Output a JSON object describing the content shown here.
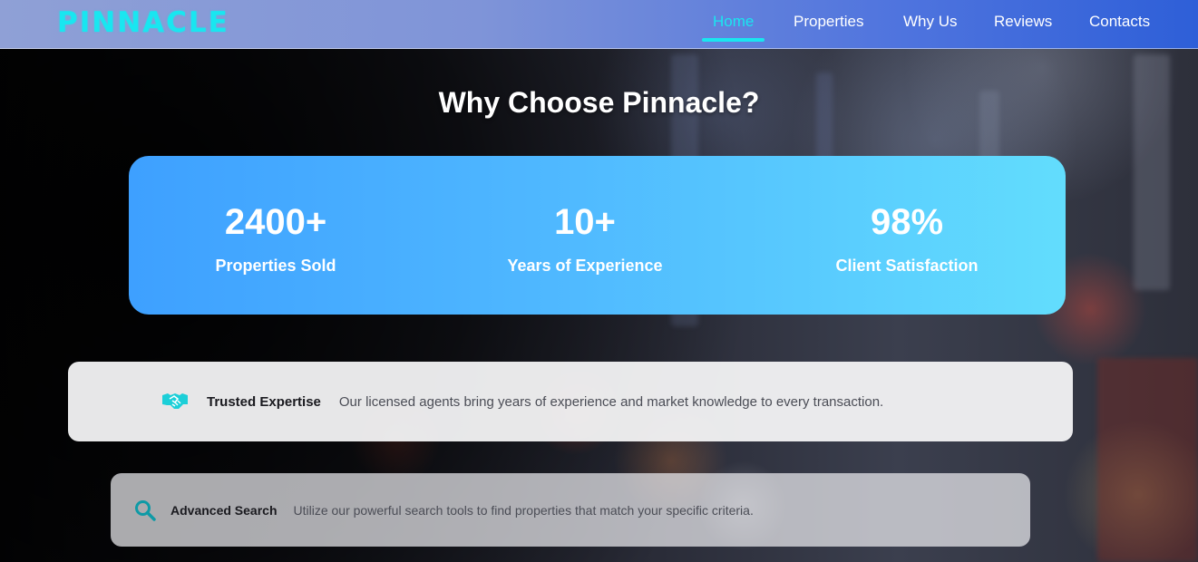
{
  "brand": {
    "logo_text": "PINNACLE"
  },
  "nav": {
    "items": [
      {
        "label": "Home",
        "active": true
      },
      {
        "label": "Properties"
      },
      {
        "label": "Why Us"
      },
      {
        "label": "Reviews"
      },
      {
        "label": "Contacts"
      }
    ]
  },
  "section": {
    "title": "Why Choose Pinnacle?"
  },
  "stats": [
    {
      "value": "2400+",
      "label": "Properties Sold"
    },
    {
      "value": "10+",
      "label": "Years of Experience"
    },
    {
      "value": "98%",
      "label": "Client Satisfaction"
    }
  ],
  "features": [
    {
      "icon": "handshake-icon",
      "title": "Trusted Expertise",
      "description": "Our licensed agents bring years of experience and market knowledge to every transaction."
    },
    {
      "icon": "search-icon",
      "title": "Advanced Search",
      "description": "Utilize our powerful search tools to find properties that match your specific criteria."
    }
  ],
  "colors": {
    "accent": "#19e6f0",
    "stats_gradient_start": "#3ea0ff",
    "stats_gradient_end": "#62ddfd",
    "icon_teal": "#1ccfd8"
  }
}
